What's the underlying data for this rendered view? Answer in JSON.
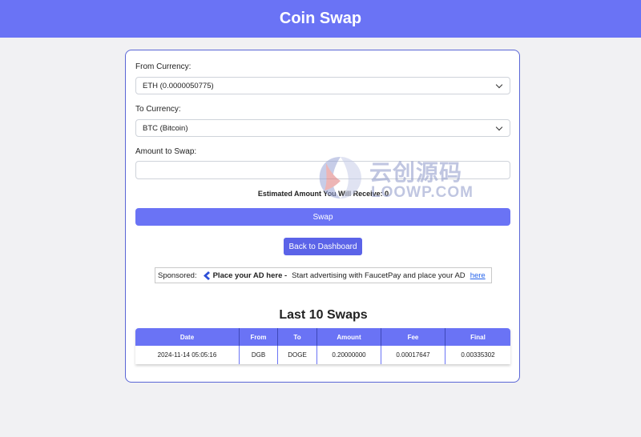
{
  "header": {
    "title": "Coin Swap"
  },
  "form": {
    "from_label": "From Currency:",
    "from_value": "ETH (0.0000050775)",
    "to_label": "To Currency:",
    "to_value": "BTC (Bitcoin)",
    "amount_label": "Amount to Swap:",
    "amount_value": "",
    "estimate_text": "Estimated Amount You Will Receive: 0",
    "swap_label": "Swap",
    "back_label": "Back to Dashboard"
  },
  "ad": {
    "prefix": "Sponsored:",
    "title": "Place your AD here -",
    "text": "Start advertising with FaucetPay and place your AD",
    "link": "here",
    "icon": "faucetpay-arrow-icon",
    "icon_color": "#2c4fd8"
  },
  "swaps": {
    "title": "Last 10 Swaps",
    "columns": [
      "Date",
      "From",
      "To",
      "Amount",
      "Fee",
      "Final"
    ],
    "rows": [
      [
        "2024-11-14 05:05:16",
        "DGB",
        "DOGE",
        "0.20000000",
        "0.00017647",
        "0.00335302"
      ]
    ]
  },
  "watermark": {
    "line1": "云创源码",
    "line2": "LOOWP.COM"
  },
  "colors": {
    "accent": "#6a73f5",
    "button_dark": "#5b63e8",
    "link": "#2563eb"
  }
}
